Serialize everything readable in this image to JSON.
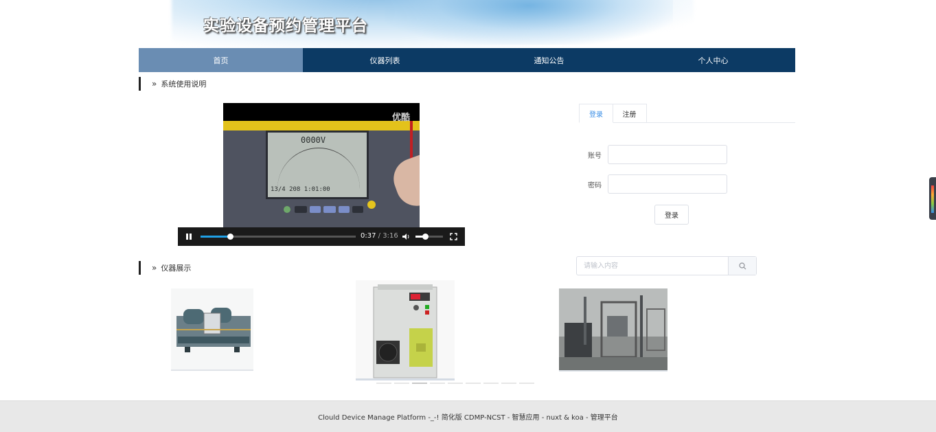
{
  "header": {
    "title": "实验设备预约管理平台"
  },
  "nav": {
    "items": [
      {
        "label": "首页",
        "active": true
      },
      {
        "label": "仪器列表",
        "active": false
      },
      {
        "label": "通知公告",
        "active": false
      },
      {
        "label": "个人中心",
        "active": false
      }
    ]
  },
  "sections": {
    "usage": "系统使用说明",
    "instruments": "仪器展示"
  },
  "video": {
    "watermark": "优酷",
    "current_time": "0:37",
    "separator": "/",
    "duration": "3:16",
    "progress_fraction": 0.19,
    "volume_fraction": 0.35,
    "screen_readout": "0000V",
    "screen_footer": "13/4 208 1:01:00"
  },
  "login": {
    "tab_login": "登录",
    "tab_register": "注册",
    "account_label": "账号",
    "password_label": "密码",
    "submit_label": "登录"
  },
  "search": {
    "placeholder": "请输入内容"
  },
  "footer": {
    "text": "Clould Device Manage Platform -_-! 简化版 CDMP-NCST - 智慧应用 - nuxt & koa - 管理平台"
  },
  "colors": {
    "nav_bg": "#0c3a64",
    "nav_active": "#6a8db3",
    "accent": "#3a8ee6",
    "footer_bg": "#e8e8e8"
  }
}
